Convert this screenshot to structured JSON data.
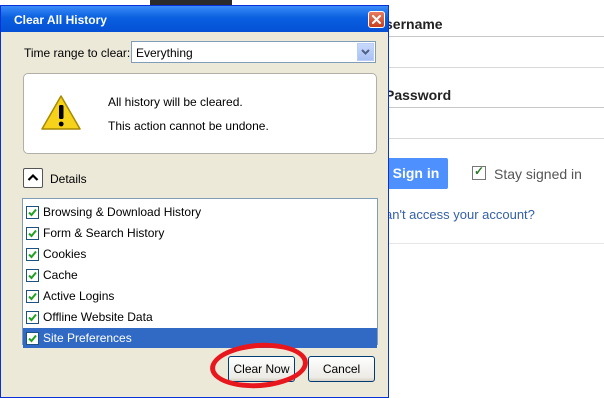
{
  "background": {
    "username_label": "sername",
    "password_label": "Password",
    "signin_label": "Sign in",
    "stay_signed_in_label": "Stay signed in",
    "stay_signed_in_checked": true,
    "cant_access_link": "an't access your account?"
  },
  "dialog": {
    "title": "Clear All History",
    "time_range_label": "Time range to clear:",
    "time_range_value": "Everything",
    "warning_line1": "All history will be cleared.",
    "warning_line2": "This action cannot be undone.",
    "details_label": "Details",
    "items": [
      {
        "label": "Browsing & Download History",
        "checked": true,
        "selected": false
      },
      {
        "label": "Form & Search History",
        "checked": true,
        "selected": false
      },
      {
        "label": "Cookies",
        "checked": true,
        "selected": false
      },
      {
        "label": "Cache",
        "checked": true,
        "selected": false
      },
      {
        "label": "Active Logins",
        "checked": true,
        "selected": false
      },
      {
        "label": "Offline Website Data",
        "checked": true,
        "selected": false
      },
      {
        "label": "Site Preferences",
        "checked": true,
        "selected": true
      }
    ],
    "clear_now_label": "Clear Now",
    "cancel_label": "Cancel"
  },
  "colors": {
    "titlebar": "#0a5fe0",
    "selection": "#316ac5",
    "annotation_circle": "#e8171d",
    "signin_button": "#4d90fe"
  },
  "icons": [
    "close-icon",
    "dropdown-arrow-icon",
    "warning-icon",
    "collapse-chevron-icon",
    "checkmark-icon"
  ]
}
